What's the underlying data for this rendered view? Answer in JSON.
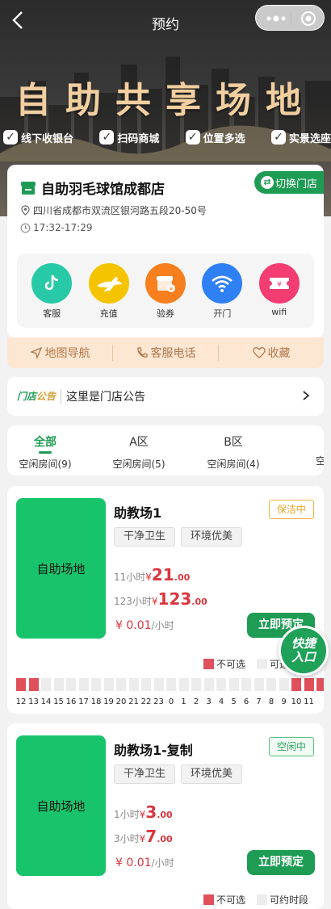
{
  "nav": {
    "back_icon": "chevron-left-icon",
    "title": "预约"
  },
  "banner": {
    "title": "自助共享场地",
    "features": [
      "线下收银台",
      "扫码商城",
      "位置多选",
      "实景选座"
    ]
  },
  "store": {
    "name": "自助羽毛球馆成都店",
    "switch_label": "切换门店",
    "address": "四川省成都市双流区银河路五段20-50号",
    "hours": "17:32-17:29",
    "services": [
      {
        "label": "客服",
        "icon": "tiktok-icon",
        "color": "#28c9a6"
      },
      {
        "label": "充值",
        "icon": "kangaroo-icon",
        "color": "#f5c400"
      },
      {
        "label": "验券",
        "icon": "store-voucher-icon",
        "color": "#f77f1e"
      },
      {
        "label": "开门",
        "icon": "wifi-icon",
        "color": "#2f80f5"
      },
      {
        "label": "wifi",
        "icon": "ticket-icon",
        "color": "#f23c72"
      }
    ]
  },
  "actions": {
    "map": "地图导航",
    "phone": "客服电话",
    "favorite": "收藏"
  },
  "notice": {
    "logo_a": "门店",
    "logo_b": "公告",
    "text": "这里是门店公告"
  },
  "tabs": [
    {
      "name": "全部",
      "sub": "空闲房间(9)",
      "active": true
    },
    {
      "name": "A区",
      "sub": "空闲房间(5)"
    },
    {
      "name": "B区",
      "sub": "空闲房间(4)"
    },
    {
      "name": "",
      "sub": "空闲房"
    }
  ],
  "rooms": [
    {
      "thumb_label": "自助场地",
      "title": "助教场1",
      "status": "保洁中",
      "tags": [
        "干净卫生",
        "环境优美"
      ],
      "price1_prefix": "11小时",
      "price1_int": "21",
      "price1_dec": ".00",
      "price2_prefix": "123小时",
      "price2_int": "123",
      "price2_dec": ".00",
      "unit_price": "¥ 0.01",
      "unit": "/小时",
      "book": "立即预定",
      "legend_busy": "不可选",
      "legend_free": "可选",
      "hours": [
        "12",
        "13",
        "14",
        "15",
        "16",
        "17",
        "18",
        "19",
        "20",
        "21",
        "22",
        "23",
        "0",
        "1",
        "2",
        "3",
        "4",
        "5",
        "6",
        "7",
        "8",
        "9",
        "10",
        "11"
      ],
      "busy": [
        0,
        1,
        22,
        23,
        24,
        25
      ]
    },
    {
      "thumb_label": "自助场地",
      "title": "助教场1-复制",
      "status": "空闲中",
      "tags": [
        "干净卫生",
        "环境优美"
      ],
      "price1_prefix": "1小时",
      "price1_int": "3",
      "price1_dec": ".00",
      "price2_prefix": "3小时",
      "price2_int": "7",
      "price2_dec": ".00",
      "unit_price": "¥ 0.01",
      "unit": "/小时",
      "book": "立即预定",
      "legend_busy": "不可选",
      "legend_free": "可约时段"
    }
  ],
  "quick_entry": {
    "line1": "快捷",
    "line2": "入口"
  },
  "yen": "¥"
}
